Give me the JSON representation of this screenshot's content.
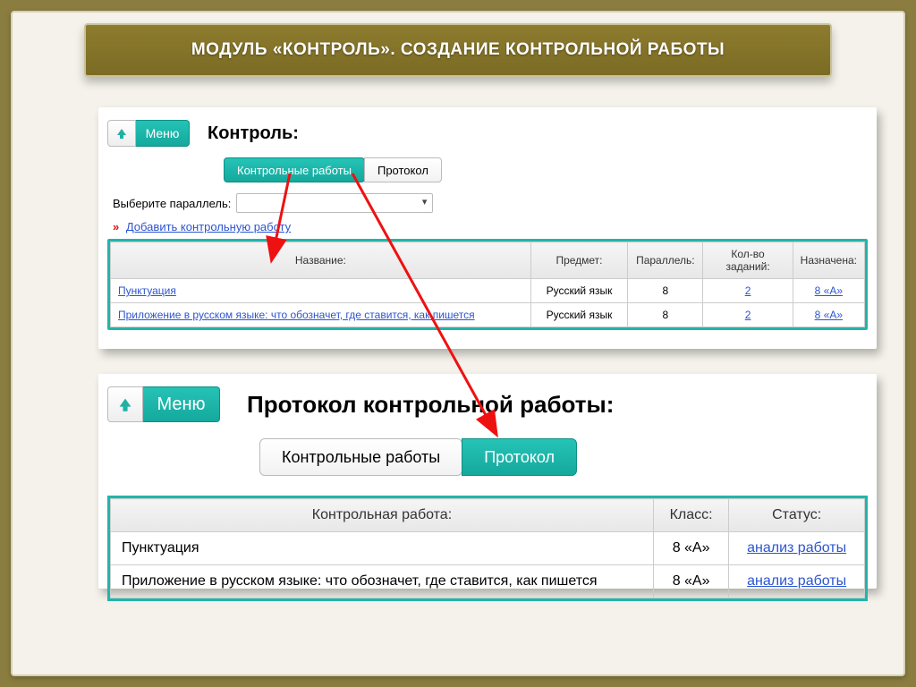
{
  "slide_title": "МОДУЛЬ «КОНТРОЛЬ». СОЗДАНИЕ КОНТРОЛЬНОЙ РАБОТЫ",
  "panel1": {
    "menu_label": "Меню",
    "heading": "Контроль:",
    "tabs": {
      "works": "Контрольные работы",
      "protocol": "Протокол"
    },
    "parallel_label": "Выберите параллель:",
    "add_link": "Добавить контрольную работу",
    "table": {
      "headers": {
        "name": "Название:",
        "subject": "Предмет:",
        "parallel": "Параллель:",
        "tasks": "Кол-во заданий:",
        "assigned": "Назначена:"
      },
      "rows": [
        {
          "name": "Пунктуация",
          "subject": "Русский язык",
          "parallel": "8",
          "tasks": "2",
          "assigned": "8 «А»"
        },
        {
          "name": "Приложение в русском языке: что обозначет, где ставится, как пишется",
          "subject": "Русский язык",
          "parallel": "8",
          "tasks": "2",
          "assigned": "8 «А»"
        }
      ]
    }
  },
  "panel2": {
    "menu_label": "Меню",
    "heading": "Протокол контрольной работы:",
    "tabs": {
      "works": "Контрольные работы",
      "protocol": "Протокол"
    },
    "table": {
      "headers": {
        "work": "Контрольная работа:",
        "class": "Класс:",
        "status": "Статус:"
      },
      "rows": [
        {
          "work": "Пунктуация",
          "class": "8 «А»",
          "status": "анализ работы"
        },
        {
          "work": "Приложение в русском языке: что обозначет, где ставится, как пишется",
          "class": "8 «А»",
          "status": "анализ работы"
        }
      ]
    }
  }
}
